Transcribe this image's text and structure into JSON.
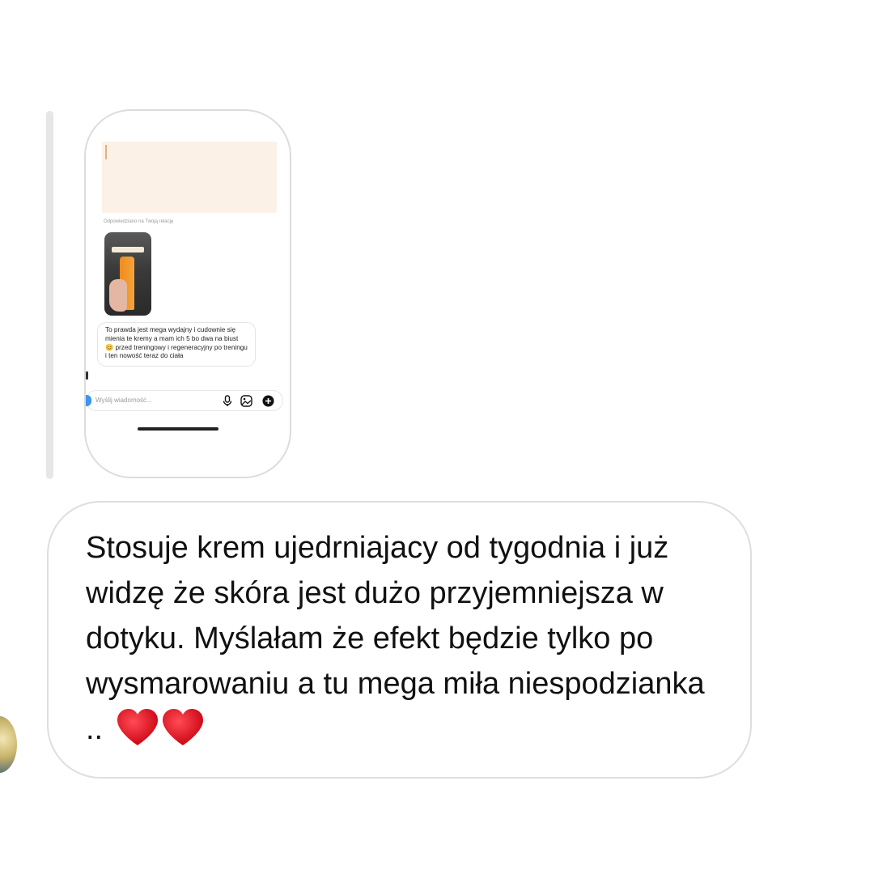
{
  "replied_story": {
    "replied_label": "Odpowiedziano na Twoją relację",
    "story_caption": "",
    "message_text": "To prawda jest mega wydajny i cudownie się mienia te kremy a mam ich 5 bo dwa na biust 😊 przed treningowy i regeneracyjny po treningu i ten nowość teraz do ciała",
    "input_placeholder": "Wyślij wiadomość...",
    "icons": [
      "camera-icon",
      "microphone-icon",
      "gallery-icon",
      "plus-icon"
    ]
  },
  "message": {
    "text": "Stosuje krem ujedrniajacy od tygodnia i już widzę  że skóra jest dużo przyjemniejsza w dotyku. Myślałam że efekt będzie tylko po wysmarowaniu a tu mega miła niespodzianka ..",
    "emoji": "❤️❤️"
  },
  "colors": {
    "bubble_border": "#dedede",
    "shared_block": "#fcf1e6",
    "accent": "#3897f0",
    "heart": "#e0101c"
  }
}
